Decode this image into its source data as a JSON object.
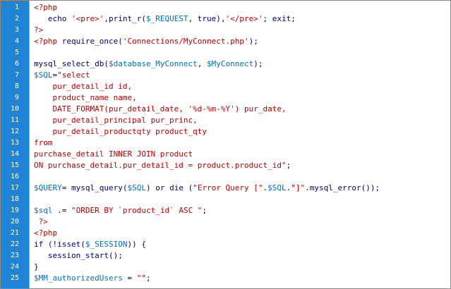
{
  "colors": {
    "gutter": "#1f84d6",
    "php_tag": "#c00000",
    "keyword": "#000080",
    "string": "#c00000",
    "variable": "#0070c0"
  },
  "lines": [
    {
      "n": "1",
      "tokens": [
        {
          "c": "php",
          "t": "<?php"
        }
      ]
    },
    {
      "n": "2",
      "tokens": [
        {
          "c": "plain",
          "t": "   echo "
        },
        {
          "c": "str",
          "t": "'<pre>'"
        },
        {
          "c": "plain",
          "t": ",print_r("
        },
        {
          "c": "var",
          "t": "$_REQUEST"
        },
        {
          "c": "plain",
          "t": ", true),"
        },
        {
          "c": "str",
          "t": "'</pre>'"
        },
        {
          "c": "plain",
          "t": "; exit;"
        }
      ]
    },
    {
      "n": "3",
      "tokens": [
        {
          "c": "php",
          "t": "?>"
        }
      ]
    },
    {
      "n": "4",
      "tokens": [
        {
          "c": "php",
          "t": "<?php"
        },
        {
          "c": "plain",
          "t": " require_once("
        },
        {
          "c": "str",
          "t": "'Connections/MyConnect.php'"
        },
        {
          "c": "plain",
          "t": ");"
        }
      ]
    },
    {
      "n": "5",
      "tokens": []
    },
    {
      "n": "6",
      "tokens": [
        {
          "c": "plain",
          "t": "mysql_select_db("
        },
        {
          "c": "var",
          "t": "$database_MyConnect"
        },
        {
          "c": "plain",
          "t": ", "
        },
        {
          "c": "var",
          "t": "$MyConnect"
        },
        {
          "c": "plain",
          "t": ");"
        }
      ]
    },
    {
      "n": "7",
      "tokens": [
        {
          "c": "var",
          "t": "$SQL"
        },
        {
          "c": "plain",
          "t": "="
        },
        {
          "c": "str",
          "t": "\"select"
        }
      ]
    },
    {
      "n": "8",
      "tokens": [
        {
          "c": "str",
          "t": "    pur_detail_id id,"
        }
      ]
    },
    {
      "n": "9",
      "tokens": [
        {
          "c": "str",
          "t": "    product_name name,"
        }
      ]
    },
    {
      "n": "10",
      "tokens": [
        {
          "c": "str",
          "t": "    DATE_FORMAT(pur_detail_date, '%d-%m-%Y') pur_date,"
        }
      ]
    },
    {
      "n": "11",
      "tokens": [
        {
          "c": "str",
          "t": "    pur_detail_principal pur_princ,"
        }
      ]
    },
    {
      "n": "12",
      "tokens": [
        {
          "c": "str",
          "t": "    pur_detail_productqty product_qty"
        }
      ]
    },
    {
      "n": "13",
      "tokens": [
        {
          "c": "str",
          "t": "from"
        }
      ]
    },
    {
      "n": "14",
      "tokens": [
        {
          "c": "str",
          "t": "purchase_detail INNER JOIN product"
        }
      ]
    },
    {
      "n": "15",
      "tokens": [
        {
          "c": "str",
          "t": "ON purchase_detail.pur_detail_id = product.product_id\""
        },
        {
          "c": "plain",
          "t": ";"
        }
      ]
    },
    {
      "n": "16",
      "tokens": []
    },
    {
      "n": "17",
      "tokens": [
        {
          "c": "var",
          "t": "$QUERY"
        },
        {
          "c": "plain",
          "t": "= mysql_query("
        },
        {
          "c": "var",
          "t": "$SQL"
        },
        {
          "c": "plain",
          "t": ") or die ("
        },
        {
          "c": "str",
          "t": "\"Error Query [\""
        },
        {
          "c": "plain",
          "t": "."
        },
        {
          "c": "var",
          "t": "$SQL"
        },
        {
          "c": "plain",
          "t": "."
        },
        {
          "c": "str",
          "t": "\"]\""
        },
        {
          "c": "plain",
          "t": ".mysql_error());"
        }
      ]
    },
    {
      "n": "18",
      "tokens": []
    },
    {
      "n": "19",
      "tokens": [
        {
          "c": "var",
          "t": "$sql"
        },
        {
          "c": "plain",
          "t": " .= "
        },
        {
          "c": "str",
          "t": "\"ORDER BY `product_id` ASC \""
        },
        {
          "c": "plain",
          "t": ";"
        }
      ]
    },
    {
      "n": "20",
      "tokens": [
        {
          "c": "php",
          "t": " ?>"
        }
      ]
    },
    {
      "n": "21",
      "tokens": [
        {
          "c": "php",
          "t": "<?php"
        }
      ]
    },
    {
      "n": "22",
      "tokens": [
        {
          "c": "plain",
          "t": "if (!isset("
        },
        {
          "c": "var",
          "t": "$_SESSION"
        },
        {
          "c": "plain",
          "t": ")) {"
        }
      ]
    },
    {
      "n": "23",
      "tokens": [
        {
          "c": "plain",
          "t": "   session_start();"
        }
      ]
    },
    {
      "n": "24",
      "tokens": [
        {
          "c": "plain",
          "t": "}"
        }
      ]
    },
    {
      "n": "25",
      "tokens": [
        {
          "c": "var",
          "t": "$MM_authorizedUsers"
        },
        {
          "c": "plain",
          "t": " = "
        },
        {
          "c": "str",
          "t": "\"\""
        },
        {
          "c": "plain",
          "t": ";"
        }
      ]
    }
  ]
}
